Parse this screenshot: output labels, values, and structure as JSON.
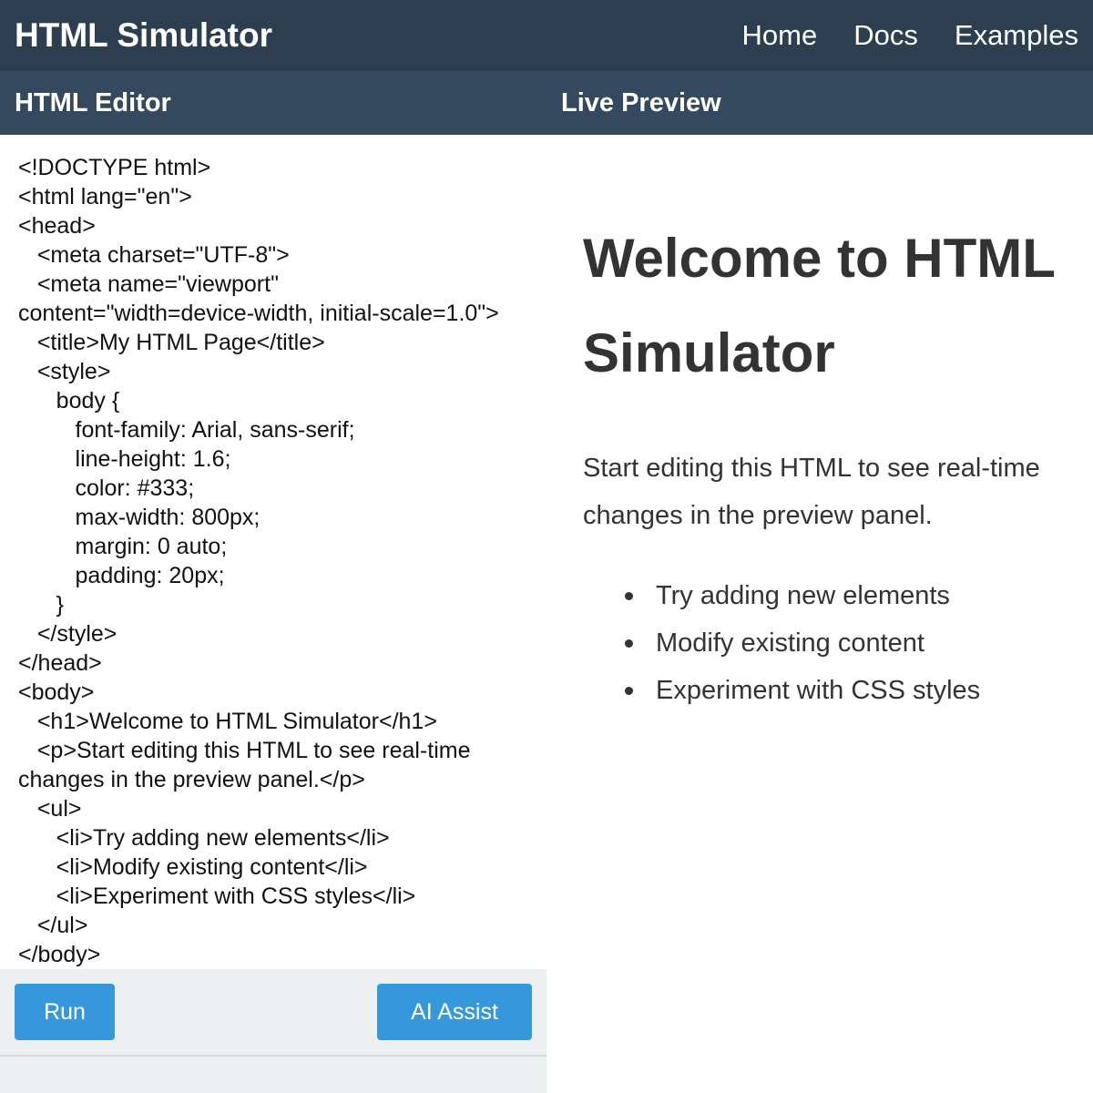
{
  "app": {
    "title": "HTML Simulator"
  },
  "nav": {
    "items": [
      "Home",
      "Docs",
      "Examples"
    ]
  },
  "panels": {
    "editor_title": "HTML Editor",
    "preview_title": "Live Preview"
  },
  "editor": {
    "lines": [
      "<!DOCTYPE html>",
      "<html lang=\"en\">",
      "<head>",
      "   <meta charset=\"UTF-8\">",
      "   <meta name=\"viewport\"",
      "content=\"width=device-width, initial-scale=1.0\">",
      "   <title>My HTML Page</title>",
      "   <style>",
      "      body {",
      "         font-family: Arial, sans-serif;",
      "         line-height: 1.6;",
      "         color: #333;",
      "         max-width: 800px;",
      "         margin: 0 auto;",
      "         padding: 20px;",
      "      }",
      "   </style>",
      "</head>",
      "<body>",
      "   <h1>Welcome to HTML Simulator</h1>",
      "   <p>Start editing this HTML to see real-time",
      "changes in the preview panel.</p>",
      "   <ul>",
      "      <li>Try adding new elements</li>",
      "      <li>Modify existing content</li>",
      "      <li>Experiment with CSS styles</li>",
      "   </ul>",
      "</body>"
    ]
  },
  "toolbar": {
    "run_label": "Run",
    "ai_label": "AI Assist"
  },
  "preview": {
    "heading": "Welcome to HTML Simulator",
    "paragraph": "Start editing this HTML to see real-time changes in the preview panel.",
    "list": [
      "Try adding new elements",
      "Modify existing content",
      "Experiment with CSS styles"
    ]
  },
  "colors": {
    "topbar": "#2c3e50",
    "panel_header": "#34495e",
    "button": "#3498db",
    "toolbar": "#ecf0f1"
  }
}
